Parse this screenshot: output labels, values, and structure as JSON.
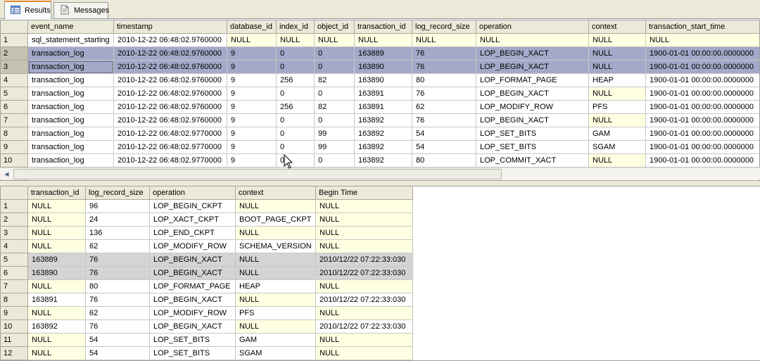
{
  "tabs": [
    {
      "label": "Results",
      "icon": "grid-icon",
      "active": true
    },
    {
      "label": "Messages",
      "icon": "messages-icon",
      "active": false
    }
  ],
  "grid1": {
    "columns": [
      "event_name",
      "timestamp",
      "database_id",
      "index_id",
      "object_id",
      "transaction_id",
      "log_record_size",
      "operation",
      "context",
      "transaction_start_time"
    ],
    "rows": [
      {
        "num": "1",
        "cells": [
          "sql_statement_starting",
          "2010-12-22 06:48:02.9760000",
          "NULL",
          "NULL",
          "NULL",
          "NULL",
          "NULL",
          "NULL",
          "NULL",
          "NULL"
        ]
      },
      {
        "num": "2",
        "cells": [
          "transaction_log",
          "2010-12-22 06:48:02.9760000",
          "9",
          "0",
          "0",
          "163889",
          "76",
          "LOP_BEGIN_XACT",
          "NULL",
          "1900-01-01 00:00:00.0000000"
        ]
      },
      {
        "num": "3",
        "cells": [
          "transaction_log",
          "2010-12-22 06:48:02.9760000",
          "9",
          "0",
          "0",
          "163890",
          "76",
          "LOP_BEGIN_XACT",
          "NULL",
          "1900-01-01 00:00:00.0000000"
        ]
      },
      {
        "num": "4",
        "cells": [
          "transaction_log",
          "2010-12-22 06:48:02.9760000",
          "9",
          "256",
          "82",
          "163890",
          "80",
          "LOP_FORMAT_PAGE",
          "HEAP",
          "1900-01-01 00:00:00.0000000"
        ]
      },
      {
        "num": "5",
        "cells": [
          "transaction_log",
          "2010-12-22 06:48:02.9760000",
          "9",
          "0",
          "0",
          "163891",
          "76",
          "LOP_BEGIN_XACT",
          "NULL",
          "1900-01-01 00:00:00.0000000"
        ]
      },
      {
        "num": "6",
        "cells": [
          "transaction_log",
          "2010-12-22 06:48:02.9760000",
          "9",
          "256",
          "82",
          "163891",
          "62",
          "LOP_MODIFY_ROW",
          "PFS",
          "1900-01-01 00:00:00.0000000"
        ]
      },
      {
        "num": "7",
        "cells": [
          "transaction_log",
          "2010-12-22 06:48:02.9760000",
          "9",
          "0",
          "0",
          "163892",
          "76",
          "LOP_BEGIN_XACT",
          "NULL",
          "1900-01-01 00:00:00.0000000"
        ]
      },
      {
        "num": "8",
        "cells": [
          "transaction_log",
          "2010-12-22 06:48:02.9770000",
          "9",
          "0",
          "99",
          "163892",
          "54",
          "LOP_SET_BITS",
          "GAM",
          "1900-01-01 00:00:00.0000000"
        ]
      },
      {
        "num": "9",
        "cells": [
          "transaction_log",
          "2010-12-22 06:48:02.9770000",
          "9",
          "0",
          "99",
          "163892",
          "54",
          "LOP_SET_BITS",
          "SGAM",
          "1900-01-01 00:00:00.0000000"
        ]
      },
      {
        "num": "10",
        "cells": [
          "transaction_log",
          "2010-12-22 06:48:02.9770000",
          "9",
          "0",
          "0",
          "163892",
          "80",
          "LOP_COMMIT_XACT",
          "NULL",
          "1900-01-01 00:00:00.0000000"
        ]
      }
    ]
  },
  "grid2": {
    "columns": [
      "transaction_id",
      "log_record_size",
      "operation",
      "context",
      "Begin Time"
    ],
    "rows": [
      {
        "num": "1",
        "cells": [
          "NULL",
          "96",
          "LOP_BEGIN_CKPT",
          "NULL",
          "NULL"
        ]
      },
      {
        "num": "2",
        "cells": [
          "NULL",
          "24",
          "LOP_XACT_CKPT",
          "BOOT_PAGE_CKPT",
          "NULL"
        ]
      },
      {
        "num": "3",
        "cells": [
          "NULL",
          "136",
          "LOP_END_CKPT",
          "NULL",
          "NULL"
        ]
      },
      {
        "num": "4",
        "cells": [
          "NULL",
          "62",
          "LOP_MODIFY_ROW",
          "SCHEMA_VERSION",
          "NULL"
        ]
      },
      {
        "num": "5",
        "cells": [
          "163889",
          "76",
          "LOP_BEGIN_XACT",
          "NULL",
          "2010/12/22 07:22:33:030"
        ]
      },
      {
        "num": "6",
        "cells": [
          "163890",
          "76",
          "LOP_BEGIN_XACT",
          "NULL",
          "2010/12/22 07:22:33:030"
        ]
      },
      {
        "num": "7",
        "cells": [
          "NULL",
          "80",
          "LOP_FORMAT_PAGE",
          "HEAP",
          "NULL"
        ]
      },
      {
        "num": "8",
        "cells": [
          "163891",
          "76",
          "LOP_BEGIN_XACT",
          "NULL",
          "2010/12/22 07:22:33:030"
        ]
      },
      {
        "num": "9",
        "cells": [
          "NULL",
          "62",
          "LOP_MODIFY_ROW",
          "PFS",
          "NULL"
        ]
      },
      {
        "num": "10",
        "cells": [
          "163892",
          "76",
          "LOP_BEGIN_XACT",
          "NULL",
          "2010/12/22 07:22:33:030"
        ]
      },
      {
        "num": "11",
        "cells": [
          "NULL",
          "54",
          "LOP_SET_BITS",
          "GAM",
          "NULL"
        ]
      },
      {
        "num": "12",
        "cells": [
          "NULL",
          "54",
          "LOP_SET_BITS",
          "SGAM",
          "NULL"
        ]
      }
    ]
  },
  "colors": {
    "selection": "#a3a9c8",
    "null_cell": "#ffffe1",
    "header": "#ece9d8",
    "tab_accent": "#e68b2c"
  }
}
